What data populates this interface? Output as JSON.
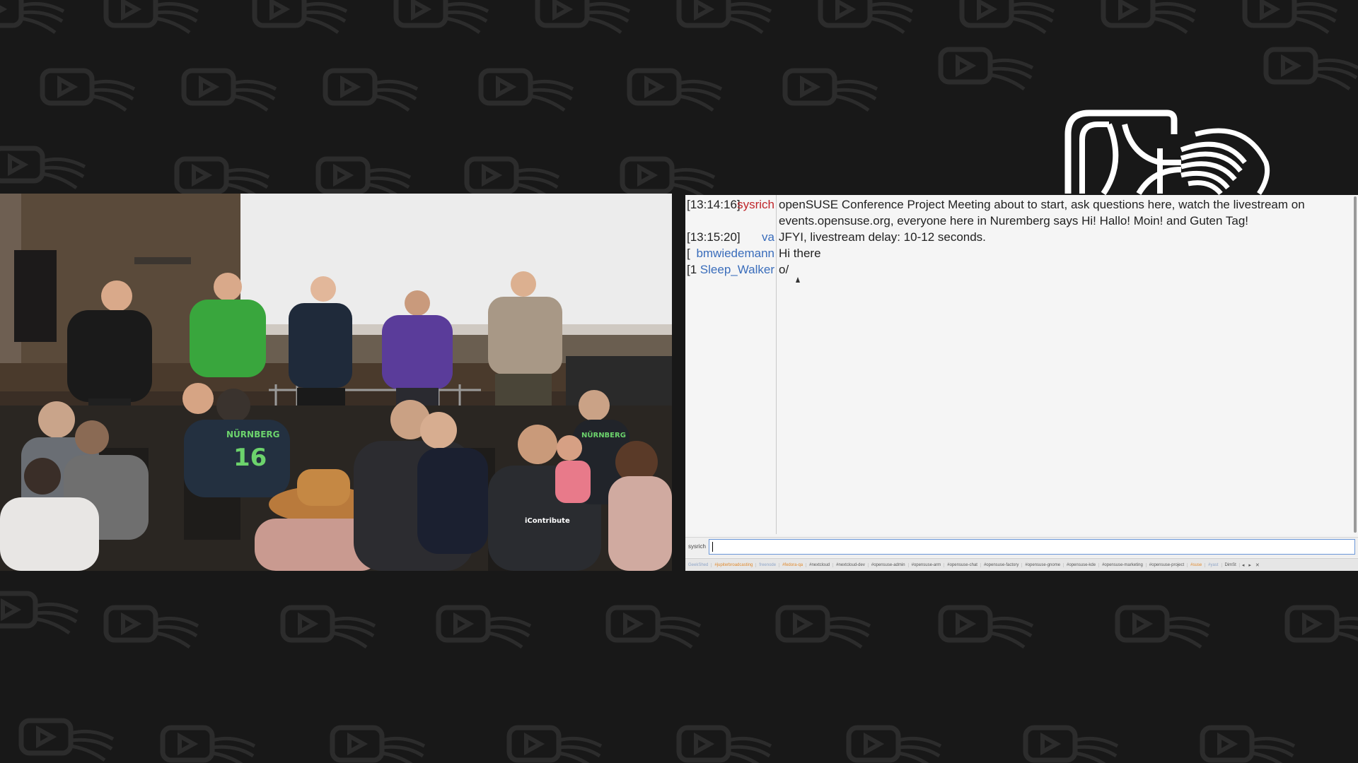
{
  "irc": {
    "lines": [
      {
        "time": "[13:14:16]",
        "nick": "sysrich",
        "nick_color": "#c0262b",
        "message": "openSUSE Conference Project Meeting about to start, ask questions here, watch the livestream on events.opensuse.org, everyone here in Nuremberg says Hi! Hallo! Moin! and Guten Tag!"
      },
      {
        "time": "[13:15:20]",
        "nick": "va",
        "nick_color": "#3a6dbb",
        "message": "JFYI, livestream delay: 10-12 seconds."
      },
      {
        "time": "[",
        "nick": "bmwiedemann",
        "nick_color": "#3a6dbb",
        "message": "Hi there"
      },
      {
        "time": "[1",
        "nick": "Sleep_Walker",
        "nick_color": "#3a6dbb",
        "message": "o/"
      }
    ],
    "input": {
      "nick": "sysrich",
      "value": ""
    },
    "channels": [
      {
        "label": "GeekShed",
        "style": "server"
      },
      {
        "label": "#jupiterbroadcasting",
        "style": "orange"
      },
      {
        "label": "freenode",
        "style": "server"
      },
      {
        "label": "#fedora-qa",
        "style": "orange"
      },
      {
        "label": "#nextcloud",
        "style": "normal"
      },
      {
        "label": "#nextcloud-dev",
        "style": "normal"
      },
      {
        "label": "#opensuse-admin",
        "style": "normal"
      },
      {
        "label": "#opensuse-arm",
        "style": "normal"
      },
      {
        "label": "#opensuse-chat",
        "style": "normal"
      },
      {
        "label": "#opensuse-factory",
        "style": "normal"
      },
      {
        "label": "#opensuse-gnome",
        "style": "normal"
      },
      {
        "label": "#opensuse-kde",
        "style": "normal"
      },
      {
        "label": "#opensuse-marketing",
        "style": "normal"
      },
      {
        "label": "#opensuse-project",
        "style": "normal"
      },
      {
        "label": "#suse",
        "style": "orange"
      },
      {
        "label": "#yast",
        "style": "server"
      },
      {
        "label": "DimSt",
        "style": "normal"
      }
    ],
    "nav_prev": "◂",
    "nav_next": "▸",
    "nav_close": "✕"
  },
  "video": {
    "shirt_text_1": "NÜRNBERG",
    "shirt_number": "16",
    "shirt_text_2": "iContribute",
    "shirt_text_3": "NÜRNBERG"
  },
  "icons": {
    "logo": "opensuse-conference-logo",
    "background": "play-button-pattern"
  }
}
